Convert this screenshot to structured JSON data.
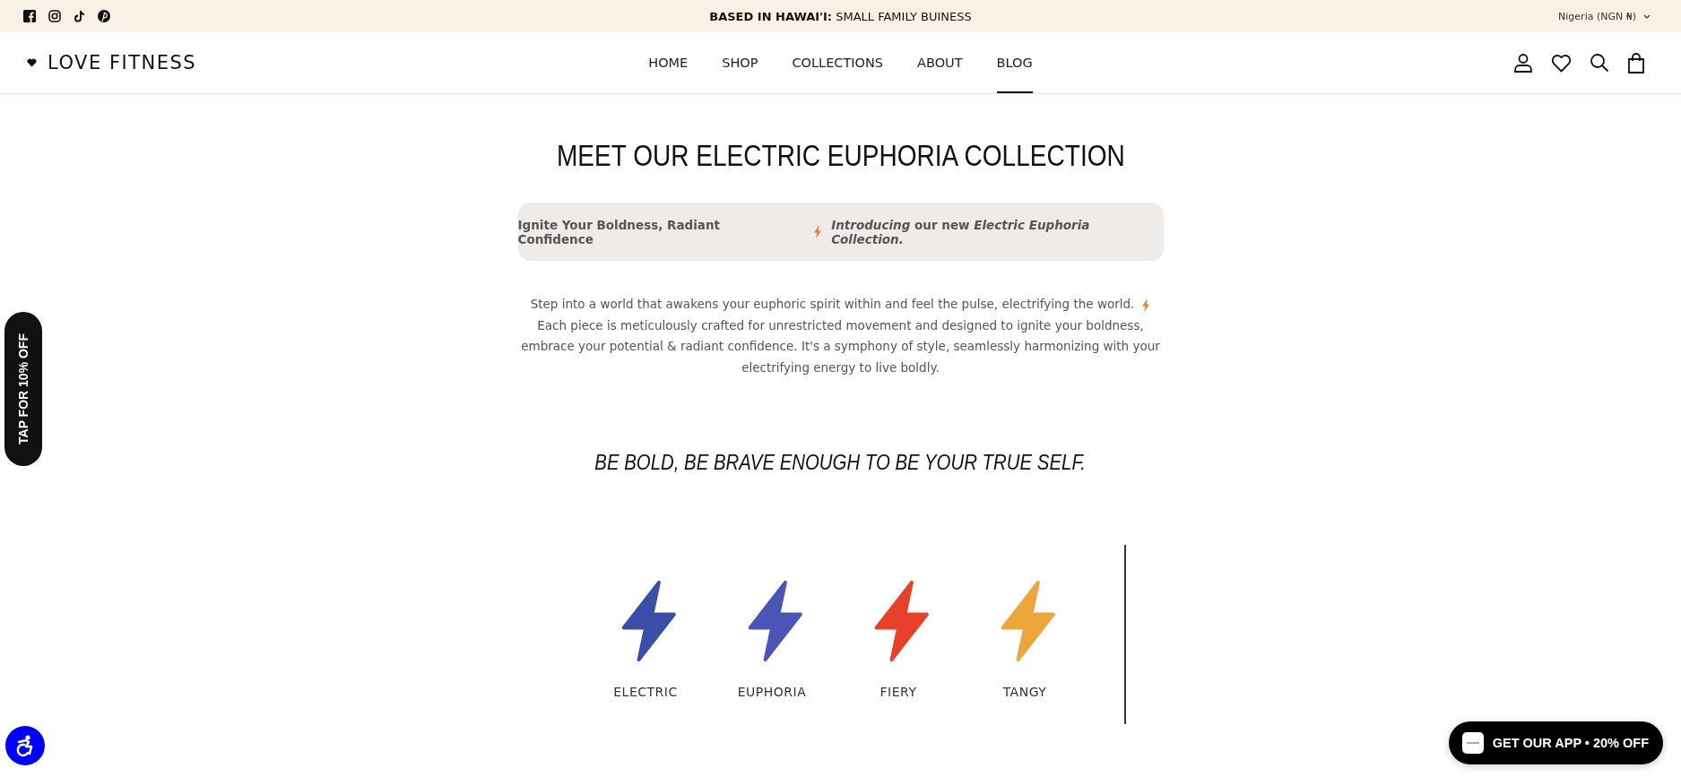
{
  "announcement": {
    "lead": "BASED IN HAWAI'I:",
    "text": "SMALL FAMILY BUINESS",
    "currency": "Nigeria (NGN ₦)"
  },
  "header": {
    "logo": "LOVE FITNESS"
  },
  "nav": [
    {
      "label": "HOME",
      "selected": false
    },
    {
      "label": "SHOP",
      "selected": false
    },
    {
      "label": "COLLECTIONS",
      "selected": false
    },
    {
      "label": "ABOUT",
      "selected": false
    },
    {
      "label": "BLOG",
      "selected": true
    }
  ],
  "title": "MEET OUR ELECTRIC EUPHORIA COLLECTION",
  "banner": {
    "lead": "Ignite Your Boldness, Radiant Confidence",
    "text": "*Introducing* our new *Electric Euphoria Collection.*"
  },
  "intro": {
    "first_line": "Step into a world that awakens your euphoric spirit within and feel the pulse, electrifying the world.",
    "rest": "Each piece is meticulously crafted for unrestricted movement and designed to ignite your boldness, embrace your potential & radiant confidence. It's a symphony of style, seamlessly harmonizing with your electrifying energy to live boldly."
  },
  "tagline": "BE BOLD, BE BRAVE ENOUGH TO BE YOUR TRUE SELF.",
  "colors": [
    {
      "label": "ELECTRIC",
      "color": "#3a4ea8"
    },
    {
      "label": "EUPHORIA",
      "color": "#4b55b8"
    },
    {
      "label": "FIERY",
      "color": "#e8402a"
    },
    {
      "label": "TANGY",
      "color": "#eca63c"
    }
  ],
  "discount_tab": "TAP FOR 10% OFF",
  "app_button": "GET OUR APP • 20% OFF"
}
